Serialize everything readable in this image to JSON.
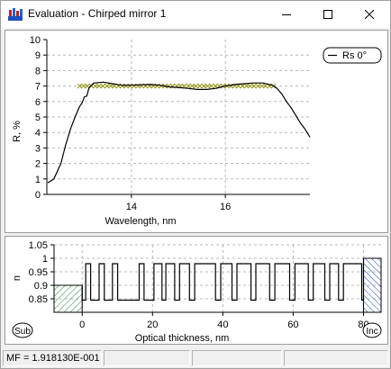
{
  "window": {
    "title": "Evaluation - Chirped mirror 1",
    "icon": "evaluation-app-icon",
    "controls": {
      "minimize_icon": "minimize-icon",
      "maximize_icon": "maximize-icon",
      "close_icon": "close-icon"
    }
  },
  "chart_data": [
    {
      "type": "line",
      "xlabel": "Wavelength, nm",
      "ylabel": "R, %",
      "xlim": [
        12.2,
        17.8
      ],
      "ylim": [
        0,
        10
      ],
      "x_ticks": [
        "14",
        "16"
      ],
      "y_ticks": [
        "0",
        "1",
        "2",
        "3",
        "4",
        "5",
        "6",
        "7",
        "8",
        "9",
        "10"
      ],
      "grid": true,
      "legend": {
        "entries": [
          "Rs 0°"
        ],
        "placement": "top-right"
      },
      "series": [
        {
          "name": "Rs 0°",
          "x": [
            12.22,
            12.35,
            12.5,
            12.6,
            12.7,
            12.8,
            12.9,
            12.95,
            13.0,
            13.05,
            13.1,
            13.2,
            13.4,
            13.6,
            13.8,
            14.0,
            14.2,
            14.4,
            14.6,
            14.8,
            15.0,
            15.2,
            15.4,
            15.6,
            15.8,
            16.0,
            16.2,
            16.4,
            16.6,
            16.8,
            17.0,
            17.1,
            17.2,
            17.3,
            17.4,
            17.5,
            17.6,
            17.7,
            17.8
          ],
          "values": [
            0.75,
            1.0,
            2.0,
            3.2,
            4.2,
            5.0,
            5.7,
            5.9,
            6.3,
            6.35,
            6.9,
            7.2,
            7.25,
            7.15,
            7.05,
            7.05,
            7.08,
            7.1,
            7.05,
            6.95,
            6.9,
            6.85,
            6.78,
            6.78,
            6.85,
            7.0,
            7.1,
            7.15,
            7.2,
            7.2,
            7.05,
            6.85,
            6.5,
            6.0,
            5.6,
            5.1,
            4.6,
            4.2,
            3.7
          ]
        },
        {
          "name": "target",
          "marker": "x",
          "color": "#8b8b00",
          "x_range": [
            12.9,
            17.05
          ],
          "value": 7.0
        }
      ]
    },
    {
      "type": "bar",
      "xlabel": "Optical thickness, nm",
      "ylabel": "n",
      "xlim": [
        -8,
        85
      ],
      "ylim": [
        0.8,
        1.05
      ],
      "x_ticks": [
        "0",
        "20",
        "40",
        "60",
        "80"
      ],
      "y_ticks": [
        "0.85",
        "0.9",
        "0.95",
        "1",
        "1.05"
      ],
      "grid": true,
      "labels": {
        "substrate": "Sub",
        "incident": "Inc"
      },
      "substrate_n": 0.9,
      "incident_n": 1.0,
      "layers_high_n": 0.98,
      "layers_low_n": 0.845,
      "layer_boundaries": [
        1,
        2.4,
        4.8,
        6.3,
        8.6,
        10.1,
        16.2,
        17.6,
        20.4,
        22.7,
        23.8,
        26.3,
        27.7,
        30.5,
        32.0,
        37.9,
        39.4,
        42.6,
        44.0,
        48.0,
        49.4,
        53.3,
        54.8,
        59.0,
        60.5,
        64.3,
        65.7,
        69.0,
        70.4,
        72.9,
        74.3,
        79.5,
        80.0
      ]
    }
  ],
  "status": {
    "mf_text": "MF = 1.918130E-001",
    "cell2": "",
    "cell3": "",
    "cell4": ""
  }
}
